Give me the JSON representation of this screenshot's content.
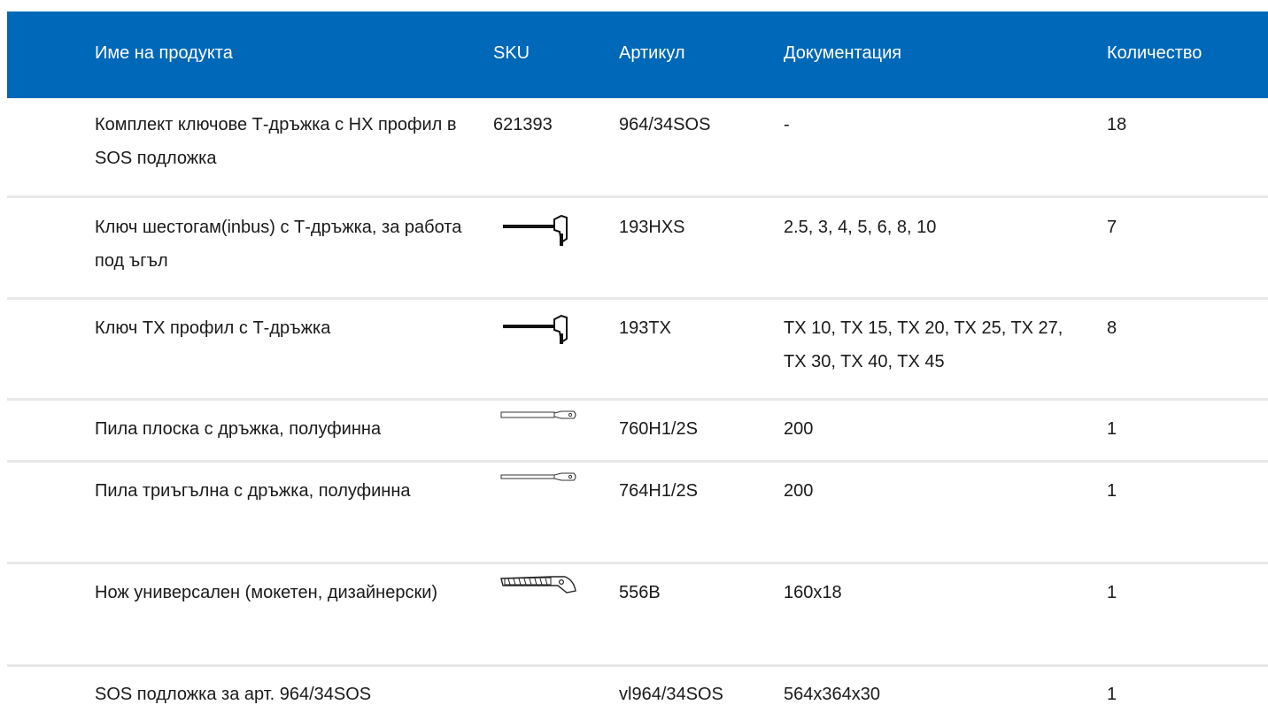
{
  "columns": {
    "name": "Име на продукта",
    "sku": "SKU",
    "article": "Артикул",
    "documentation": "Документация",
    "quantity": "Количество"
  },
  "rows": [
    {
      "name": "Комплект ключове Т-дръжка с HX профил в SOS подложка",
      "sku": "621393",
      "sku_icon": "",
      "article": "964/34SOS",
      "documentation": "-",
      "quantity": "18"
    },
    {
      "name": "Ключ шестогам(inbus) с Т-дръжка, за работа под ъгъл",
      "sku": "",
      "sku_icon": "t-handle-key-icon",
      "article": "193HXS",
      "documentation": "2.5, 3, 4, 5, 6, 8, 10",
      "quantity": "7"
    },
    {
      "name": "Ключ ТХ профил с Т-дръжка",
      "sku": "",
      "sku_icon": "t-handle-key-icon",
      "article": "193TX",
      "documentation": "TX 10, TX 15, TX 20, TX 25, TX 27, TX 30, TX 40, TX 45",
      "quantity": "8"
    },
    {
      "name": "Пила плоска с дръжка, полуфинна",
      "sku": "",
      "sku_icon": "flat-file-icon",
      "article": "760H1/2S",
      "documentation": "200",
      "quantity": "1"
    },
    {
      "name": "Пила триъгълна с дръжка, полуфинна",
      "sku": "",
      "sku_icon": "triangular-file-icon",
      "article": "764H1/2S",
      "documentation": "200",
      "quantity": "1"
    },
    {
      "name": "Нож универсален (мокетен, дизайнерски)",
      "sku": "",
      "sku_icon": "utility-knife-icon",
      "article": "556B",
      "documentation": "160x18",
      "quantity": "1"
    },
    {
      "name": "SOS подложка за арт. 964/34SOS",
      "sku": "",
      "sku_icon": "",
      "article": "vl964/34SOS",
      "documentation": "564x364x30",
      "quantity": "1"
    }
  ]
}
